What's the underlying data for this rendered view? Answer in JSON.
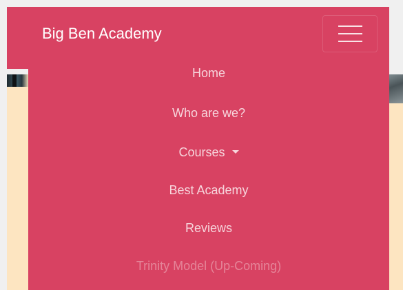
{
  "navbar": {
    "brand": "Big Ben Academy",
    "toggler_icon": "hamburger-menu-icon",
    "background_color": "#d84262"
  },
  "menu": {
    "items": [
      {
        "label": "Home"
      },
      {
        "label": "Who are we?"
      },
      {
        "label": "Courses",
        "icon": "caret-down-icon"
      },
      {
        "label": "Best Academy"
      },
      {
        "label": "Reviews"
      },
      {
        "label": "Trinity Model (Up-Coming)",
        "disabled": true
      }
    ]
  },
  "page": {
    "side_background_color": "#fde5c1"
  }
}
